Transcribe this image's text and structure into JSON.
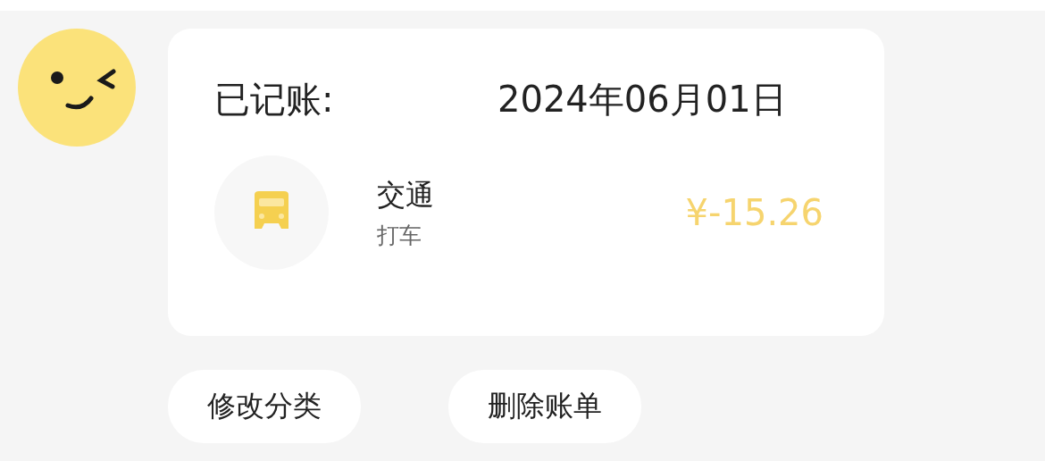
{
  "record": {
    "label": "已记账:",
    "date": "2024年06月01日",
    "entry": {
      "category": "交通",
      "note": "打车",
      "amount": "¥-15.26"
    }
  },
  "actions": [
    {
      "label": "修改分类"
    },
    {
      "label": "删除账单"
    }
  ]
}
